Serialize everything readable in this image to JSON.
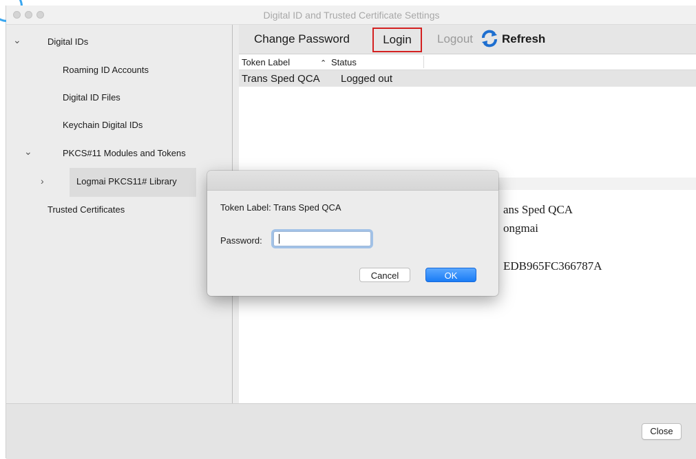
{
  "window": {
    "title": "Digital ID and Trusted Certificate Settings"
  },
  "sidebar": {
    "items": [
      {
        "label": "Digital IDs",
        "expanded": true
      },
      {
        "label": "Roaming ID Accounts"
      },
      {
        "label": "Digital ID Files"
      },
      {
        "label": "Keychain Digital IDs"
      },
      {
        "label": "PKCS#11 Modules and Tokens",
        "expanded": true
      },
      {
        "label": "Logmai PKCS11# Library",
        "selected": true,
        "expanded": false
      },
      {
        "label": "Trusted Certificates"
      }
    ]
  },
  "toolbar": {
    "change_password": "Change Password",
    "login": "Login",
    "logout": "Logout",
    "refresh": "Refresh"
  },
  "table": {
    "columns": [
      "Token Label",
      "Status"
    ],
    "sort_indicator": "^",
    "rows": [
      {
        "token_label": "Trans Sped QCA",
        "status": "Logged out"
      }
    ]
  },
  "details": {
    "line1": "ans Sped QCA",
    "line2": "ongmai",
    "line3": "EDB965FC366787A"
  },
  "dialog": {
    "token_label": "Token Label: Trans Sped QCA",
    "password_label": "Password:",
    "password_value": "",
    "cancel": "Cancel",
    "ok": "OK"
  },
  "footer": {
    "close": "Close"
  },
  "colors": {
    "login_highlight": "#d42020",
    "ok_button": "#1a7cf5",
    "refresh_icon": "#1e6fd0",
    "focus_ring": "#4a90e2"
  },
  "icons": {
    "refresh": "refresh-icon",
    "expand": "chevron-down-icon",
    "collapse": "chevron-right-icon"
  }
}
